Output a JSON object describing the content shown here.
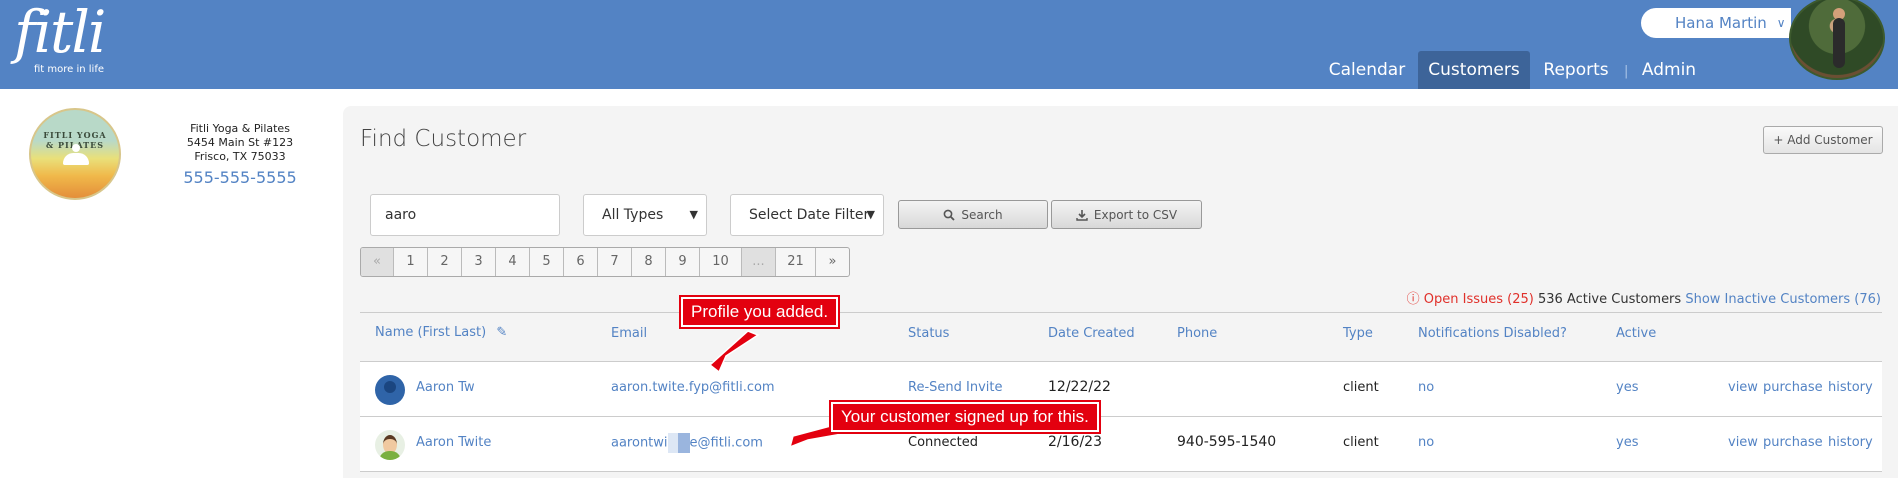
{
  "brand": {
    "wordmark": "fitli",
    "tagline": "fit more in life"
  },
  "user": {
    "name": "Hana Martin",
    "chevron": "chevron-down-icon"
  },
  "nav": [
    "Calendar",
    "Customers",
    "Reports",
    "Admin"
  ],
  "nav_separator": "|",
  "business": {
    "logo_text": "FITLI YOGA & PILATES",
    "name": "Fitli Yoga & Pilates",
    "address1": "5454 Main St #123",
    "address2": "Frisco, TX 75033",
    "phone": "555-555-5555"
  },
  "page": {
    "title": "Find Customer",
    "add_button": "+ Add Customer"
  },
  "filters": {
    "search_value": "aaro",
    "type_select": "All Types",
    "date_select": "Select Date Filter",
    "search_button": "Search",
    "export_button": "Export to CSV"
  },
  "pagination": [
    "«",
    "1",
    "2",
    "3",
    "4",
    "5",
    "6",
    "7",
    "8",
    "9",
    "10",
    "...",
    "21",
    "»"
  ],
  "summary": {
    "open_issues": "Open Issues (25)",
    "active": "536 Active Customers",
    "inactive_link": "Show Inactive Customers (76)"
  },
  "columns": [
    "Name (First Last)",
    "Email",
    "Status",
    "Date Created",
    "Phone",
    "Type",
    "Notifications Disabled?",
    "Active"
  ],
  "rows": [
    {
      "name": "Aaron Tw",
      "email": "aaron.twite.fyp@fitli.com",
      "status": "Re-Send Invite",
      "date": "12/22/22",
      "phone": "",
      "type": "client",
      "notif": "no",
      "active": "yes",
      "actions": [
        "view",
        "purchase",
        "history"
      ]
    },
    {
      "name": "Aaron Twite",
      "email_start": "aarontwi",
      "email_end": "e@fitli.com",
      "status": "Connected",
      "date": "2/16/23",
      "phone": "940-595-1540",
      "type": "client",
      "notif": "no",
      "active": "yes",
      "actions": [
        "view",
        "purchase",
        "history"
      ]
    }
  ],
  "annotations": [
    "Profile you added.",
    "Your customer signed up for this."
  ],
  "colors": {
    "header": "#5383c4",
    "active_nav": "#3d6499",
    "link": "#5383c4",
    "callout": "#e3000f"
  }
}
